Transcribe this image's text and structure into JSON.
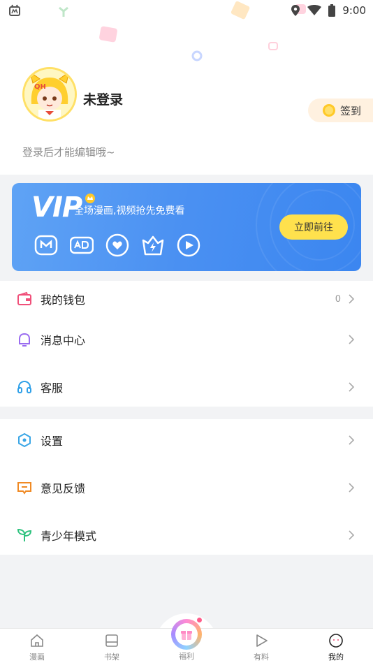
{
  "status_bar": {
    "time": "9:00"
  },
  "profile": {
    "username": "未登录",
    "signin_label": "签到",
    "hint": "登录后才能编辑哦~"
  },
  "vip": {
    "logo": "VIP",
    "tagline": "全场漫画,视频抢先免费看",
    "button": "立即前往",
    "icons": [
      "m-badge-icon",
      "ad-free-icon",
      "heart-icon",
      "lightning-crown-icon",
      "play-icon"
    ]
  },
  "menu_group_1": [
    {
      "label": "我的钱包",
      "value": "0",
      "icon": "wallet-icon",
      "color": "#f0507a"
    },
    {
      "label": "消息中心",
      "value": "",
      "icon": "bell-icon",
      "color": "#9a6cf0"
    },
    {
      "label": "客服",
      "value": "",
      "icon": "headset-icon",
      "color": "#2fa0e8"
    }
  ],
  "menu_group_2": [
    {
      "label": "设置",
      "value": "",
      "icon": "settings-hex-icon",
      "color": "#3aa6e6"
    },
    {
      "label": "意见反馈",
      "value": "",
      "icon": "feedback-icon",
      "color": "#f08a24"
    },
    {
      "label": "青少年模式",
      "value": "",
      "icon": "sprout-icon",
      "color": "#2ec27e"
    }
  ],
  "tabbar": {
    "tabs": [
      {
        "label": "漫画",
        "icon": "home-icon"
      },
      {
        "label": "书架",
        "icon": "bookshelf-icon"
      },
      {
        "label": "福利",
        "icon": "gift-icon"
      },
      {
        "label": "有料",
        "icon": "play-icon"
      },
      {
        "label": "我的",
        "icon": "face-icon"
      }
    ],
    "active": "我的"
  }
}
